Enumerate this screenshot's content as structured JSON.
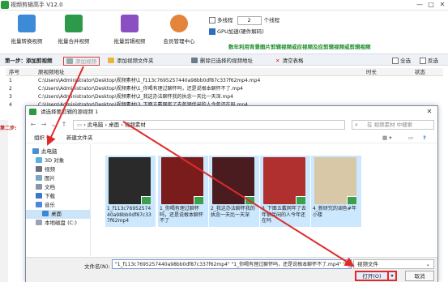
{
  "app": {
    "title": "视频剪辑高手 V12.0",
    "window_controls": [
      "—",
      "□",
      "✕"
    ]
  },
  "toolbar": [
    {
      "label": "批量转换视频",
      "icon": "film-convert-icon",
      "color": "#3b8bd6"
    },
    {
      "label": "批量合并视频",
      "icon": "film-merge-icon",
      "color": "#2c9a4a"
    },
    {
      "label": "批量剪辑视频",
      "icon": "scissors-icon",
      "color": "#8a4fc2"
    },
    {
      "label": "会员管理中心",
      "icon": "member-user-icon",
      "color": "#e2843a"
    }
  ],
  "options": {
    "multithread_label": "多线程",
    "thread_count": "2",
    "thread_unit": "个线程",
    "gpu_label": "GPU加速(硬件解码)",
    "promo": "数年利用背景图片剪辑视频或应视频及应剪辑视频或剪辑视频"
  },
  "stepbar": {
    "step1": "第一步：添加剪视频",
    "add_video": "添加视频",
    "add_folder": "添加视频文件夹",
    "delete": "删除已选择的视频地址",
    "clear": "清空表格",
    "select_all": "全选",
    "invert": "反选"
  },
  "table": {
    "headers": [
      "序号",
      "原视频地址",
      "时长",
      "状态"
    ],
    "rows": [
      {
        "n": "1",
        "path": "C:\\Users\\Administrator\\Desktop\\视频素材\\1_f113c7695257440a98bb0df87c337f62mp4.mp4"
      },
      {
        "n": "2",
        "path": "C:\\Users\\Administrator\\Desktop\\视频素材\\1_你喝有理过聊怀吗，还是说根本聊怀不了.mp4"
      },
      {
        "n": "3",
        "path": "C:\\Users\\Administrator\\Desktop\\视频素材\\2_我这办法聊怀我的执念一天比一天深.mp4"
      },
      {
        "n": "4",
        "path": "C:\\Users\\Administrator\\Desktop\\视频素材\\3_下面五戴网年了去年钢伴闲的人今年还在吗.mp4"
      }
    ]
  },
  "side": {
    "step2": "第二步:"
  },
  "dialog": {
    "title": "请选择要剪辑的源视频 1",
    "breadcrumb": [
      "此电脑",
      "桌面",
      "视频素材"
    ],
    "search_placeholder": "在 视频素材 中搜索",
    "organize": "组织 ▾",
    "new_folder": "新建文件夹",
    "nav": [
      {
        "label": "此电脑",
        "icon": "computer-icon"
      },
      {
        "label": "3D 对象",
        "icon": "cube-icon"
      },
      {
        "label": "视频",
        "icon": "video-folder-icon"
      },
      {
        "label": "图片",
        "icon": "picture-folder-icon"
      },
      {
        "label": "文档",
        "icon": "document-folder-icon"
      },
      {
        "label": "下载",
        "icon": "download-folder-icon"
      },
      {
        "label": "音乐",
        "icon": "music-folder-icon"
      },
      {
        "label": "桌面",
        "icon": "desktop-folder-icon"
      },
      {
        "label": "本地磁盘 (C:)",
        "icon": "disk-icon"
      }
    ],
    "files": [
      {
        "name": "1_f113c7695257440a98bb0df87c337f62mp4",
        "bg": "#2a2a2a"
      },
      {
        "name": "1_你喝有理过聊怀吗，还是说根本聊怀不了",
        "bg": "#7a1c1c"
      },
      {
        "name": "2_我这办法聊怀我的执念一天比一天深",
        "bg": "#4a1c20"
      },
      {
        "name": "3_下面五戴网年了去年钢伴闲的人今年还在吗",
        "bg": "#b03030"
      },
      {
        "name": "4_新研究的调色#年小楼",
        "bg": "#d8c8a8"
      }
    ],
    "filename_label": "文件名(N):",
    "filename_value": "\"1_f113c7695257440a98bb0df87c337f62mp4\" \"1_你喝有理过聊怀吗，还是说根本聊怀不了.mp4\" \"2_\"",
    "filetype": "视频文件",
    "open": "打开(O)",
    "cancel": "取消"
  },
  "colors": {
    "accent": "#2d6cc0",
    "highlight": "#e02a2a",
    "selected": "#cce8ff"
  }
}
